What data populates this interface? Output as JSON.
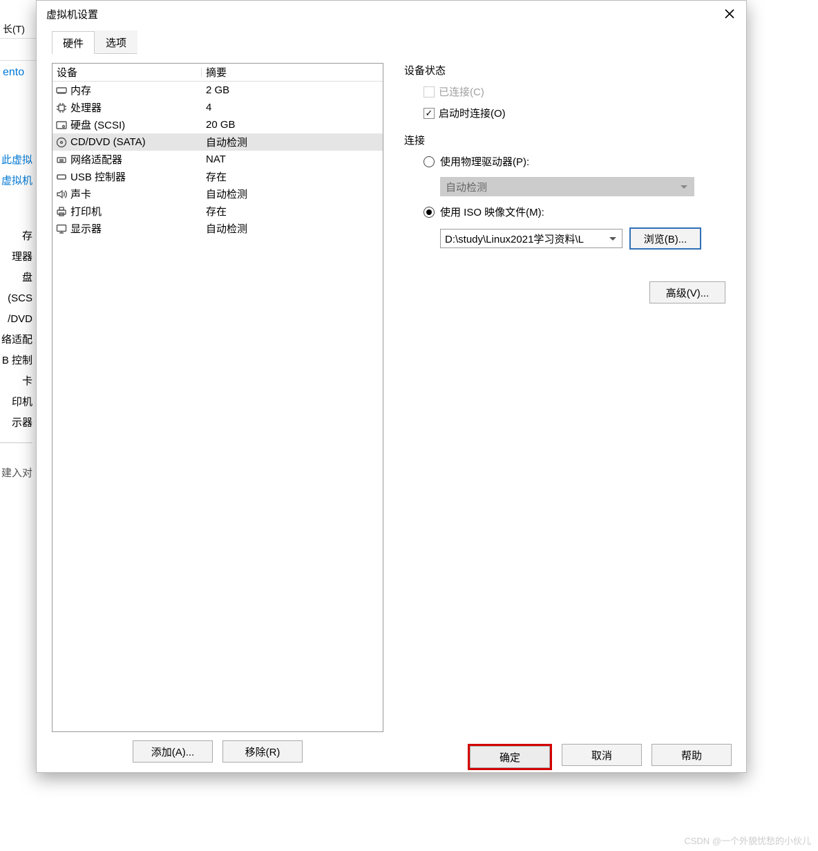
{
  "bg": {
    "menu_item": "长(T)",
    "home_tab": "ento",
    "link1": "此虚拟",
    "link2": "虚拟机",
    "side": [
      "存",
      "理器",
      "盘 (SCS",
      "/DVD",
      "络适配",
      "B 控制",
      "卡",
      "印机",
      "示器"
    ],
    "instr": "建入对"
  },
  "dialog": {
    "title": "虚拟机设置",
    "tabs": {
      "hardware": "硬件",
      "options": "选项"
    },
    "headers": {
      "device": "设备",
      "summary": "摘要"
    },
    "rows": [
      {
        "icon": "memory-icon",
        "name": "内存",
        "summary": "2 GB"
      },
      {
        "icon": "cpu-icon",
        "name": "处理器",
        "summary": "4"
      },
      {
        "icon": "disk-icon",
        "name": "硬盘 (SCSI)",
        "summary": "20 GB"
      },
      {
        "icon": "cd-icon",
        "name": "CD/DVD (SATA)",
        "summary": "自动检测",
        "selected": true
      },
      {
        "icon": "network-icon",
        "name": "网络适配器",
        "summary": "NAT"
      },
      {
        "icon": "usb-icon",
        "name": "USB 控制器",
        "summary": "存在"
      },
      {
        "icon": "sound-icon",
        "name": "声卡",
        "summary": "自动检测"
      },
      {
        "icon": "printer-icon",
        "name": "打印机",
        "summary": "存在"
      },
      {
        "icon": "display-icon",
        "name": "显示器",
        "summary": "自动检测"
      }
    ],
    "add_label": "添加(A)...",
    "remove_label": "移除(R)",
    "status": {
      "title": "设备状态",
      "connected": "已连接(C)",
      "connect_at_power": "启动时连接(O)"
    },
    "connection": {
      "title": "连接",
      "physical": "使用物理驱动器(P):",
      "physical_value": "自动检测",
      "iso": "使用 ISO 映像文件(M):",
      "iso_path": "D:\\study\\Linux2021学习资料\\L",
      "browse": "浏览(B)..."
    },
    "advanced": "高级(V)...",
    "footer": {
      "ok": "确定",
      "cancel": "取消",
      "help": "帮助"
    }
  },
  "watermark": "CSDN @一个外貌忧愁的小伙儿"
}
